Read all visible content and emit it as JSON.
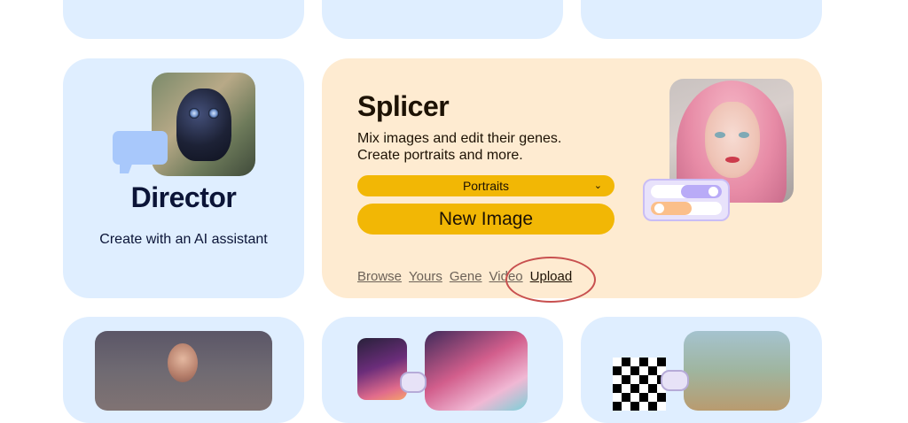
{
  "director": {
    "title": "Director",
    "subtitle": "Create with an AI assistant"
  },
  "splicer": {
    "title": "Splicer",
    "description_line1": "Mix images and edit their genes.",
    "description_line2": "Create portraits and more.",
    "select_value": "Portraits",
    "new_image_label": "New Image",
    "links": [
      "Browse",
      "Yours",
      "Gene",
      "Video",
      "Upload"
    ]
  },
  "colors": {
    "card_blue": "#dfeeff",
    "card_peach": "#feebd1",
    "accent_yellow": "#f2b705",
    "annotation_red": "#c8504f"
  },
  "icons": {
    "select": "chevron-down-icon",
    "director_bubble": "chat-bubble-icon",
    "splicer_badge": "toggle-switches-icon"
  }
}
